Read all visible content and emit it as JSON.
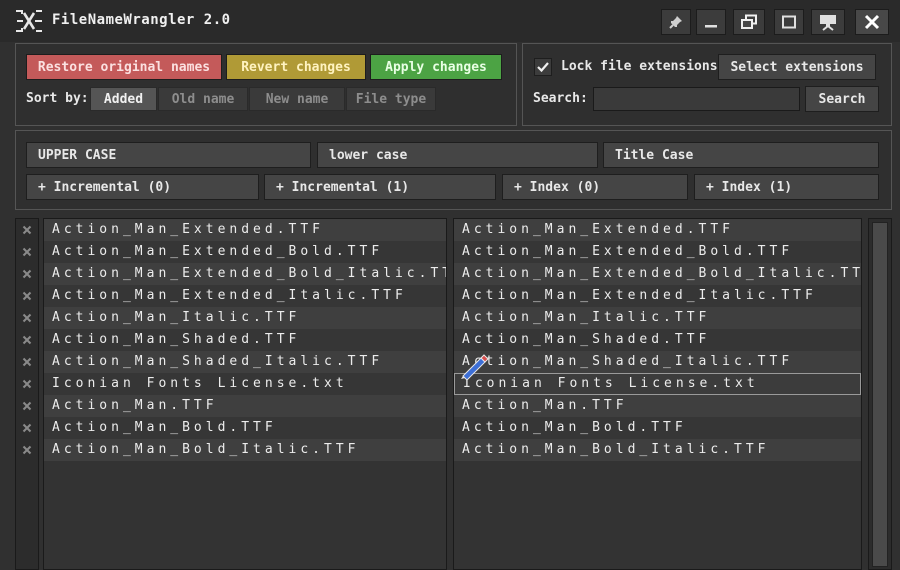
{
  "app": {
    "title": "FileNameWrangler 2.0"
  },
  "actions": {
    "restore": "Restore original names",
    "revert": "Revert changes",
    "apply": "Apply changes"
  },
  "sort": {
    "label": "Sort by:",
    "options": [
      "Added",
      "Old name",
      "New name",
      "File type"
    ],
    "selected": "Added"
  },
  "extensions": {
    "lock_label": "Lock file extensions",
    "lock_checked": true,
    "select_button": "Select extensions"
  },
  "search": {
    "label": "Search:",
    "value": "",
    "button": "Search"
  },
  "case_buttons": [
    "UPPER CASE",
    "lower case",
    "Title Case"
  ],
  "number_buttons": [
    "+ Incremental (0)",
    "+ Incremental (1)",
    "+ Index (0)",
    "+ Index (1)"
  ],
  "old_names": [
    "Action_Man_Extended.TTF",
    "Action_Man_Extended_Bold.TTF",
    "Action_Man_Extended_Bold_Italic.TTF",
    "Action_Man_Extended_Italic.TTF",
    "Action_Man_Italic.TTF",
    "Action_Man_Shaded.TTF",
    "Action_Man_Shaded_Italic.TTF",
    "Iconian Fonts License.txt",
    "Action_Man.TTF",
    "Action_Man_Bold.TTF",
    "Action_Man_Bold_Italic.TTF"
  ],
  "new_names": [
    "Action_Man_Extended.TTF",
    "Action_Man_Extended_Bold.TTF",
    "Action_Man_Extended_Bold_Italic.TTF",
    "Action_Man_Extended_Italic.TTF",
    "Action_Man_Italic.TTF",
    "Action_Man_Shaded.TTF",
    "Action_Man_Shaded_Italic.TTF",
    "Iconian Fonts License.txt",
    "Action_Man.TTF",
    "Action_Man_Bold.TTF",
    "Action_Man_Bold_Italic.TTF"
  ],
  "editing_row": 7,
  "colors": {
    "restore": "#c45a5a",
    "revert": "#b09a36",
    "apply": "#4ca344"
  },
  "icons": {
    "logo": "filenamewrangler-logo-icon",
    "pin": "pin-icon",
    "minimize": "minimize-icon",
    "restore": "restore-window-icon",
    "maximize": "maximize-icon",
    "present": "presentation-icon",
    "close": "close-icon",
    "remove": "x-icon",
    "edit": "pencil-icon"
  }
}
